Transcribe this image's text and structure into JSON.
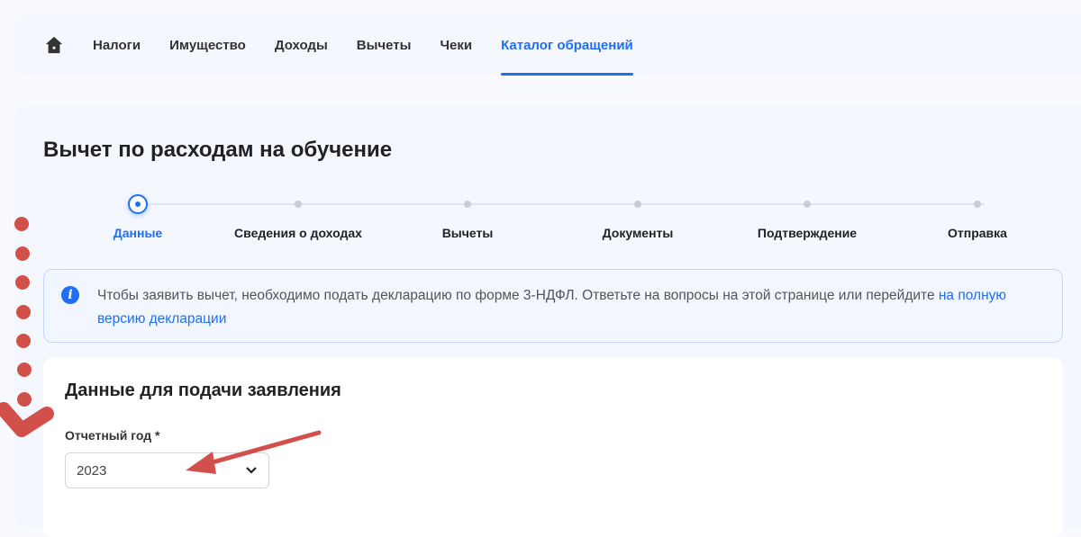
{
  "nav": {
    "items": [
      "Налоги",
      "Имущество",
      "Доходы",
      "Вычеты",
      "Чеки",
      "Каталог обращений"
    ],
    "active": "Каталог обращений"
  },
  "page": {
    "title": "Вычет по расходам на обучение"
  },
  "steps": [
    "Данные",
    "Сведения о доходах",
    "Вычеты",
    "Документы",
    "Подтверждение",
    "Отправка"
  ],
  "info": {
    "text": "Чтобы заявить вычет, необходимо подать декларацию по форме 3-НДФЛ. Ответьте на вопросы на этой странице или перейдите ",
    "link": "на полную версию декларации"
  },
  "form": {
    "title": "Данные для подачи заявления",
    "year_label": "Отчетный год *",
    "year_value": "2023"
  },
  "colors": {
    "accent": "#1f6ef5",
    "annotation": "#d2504a"
  }
}
